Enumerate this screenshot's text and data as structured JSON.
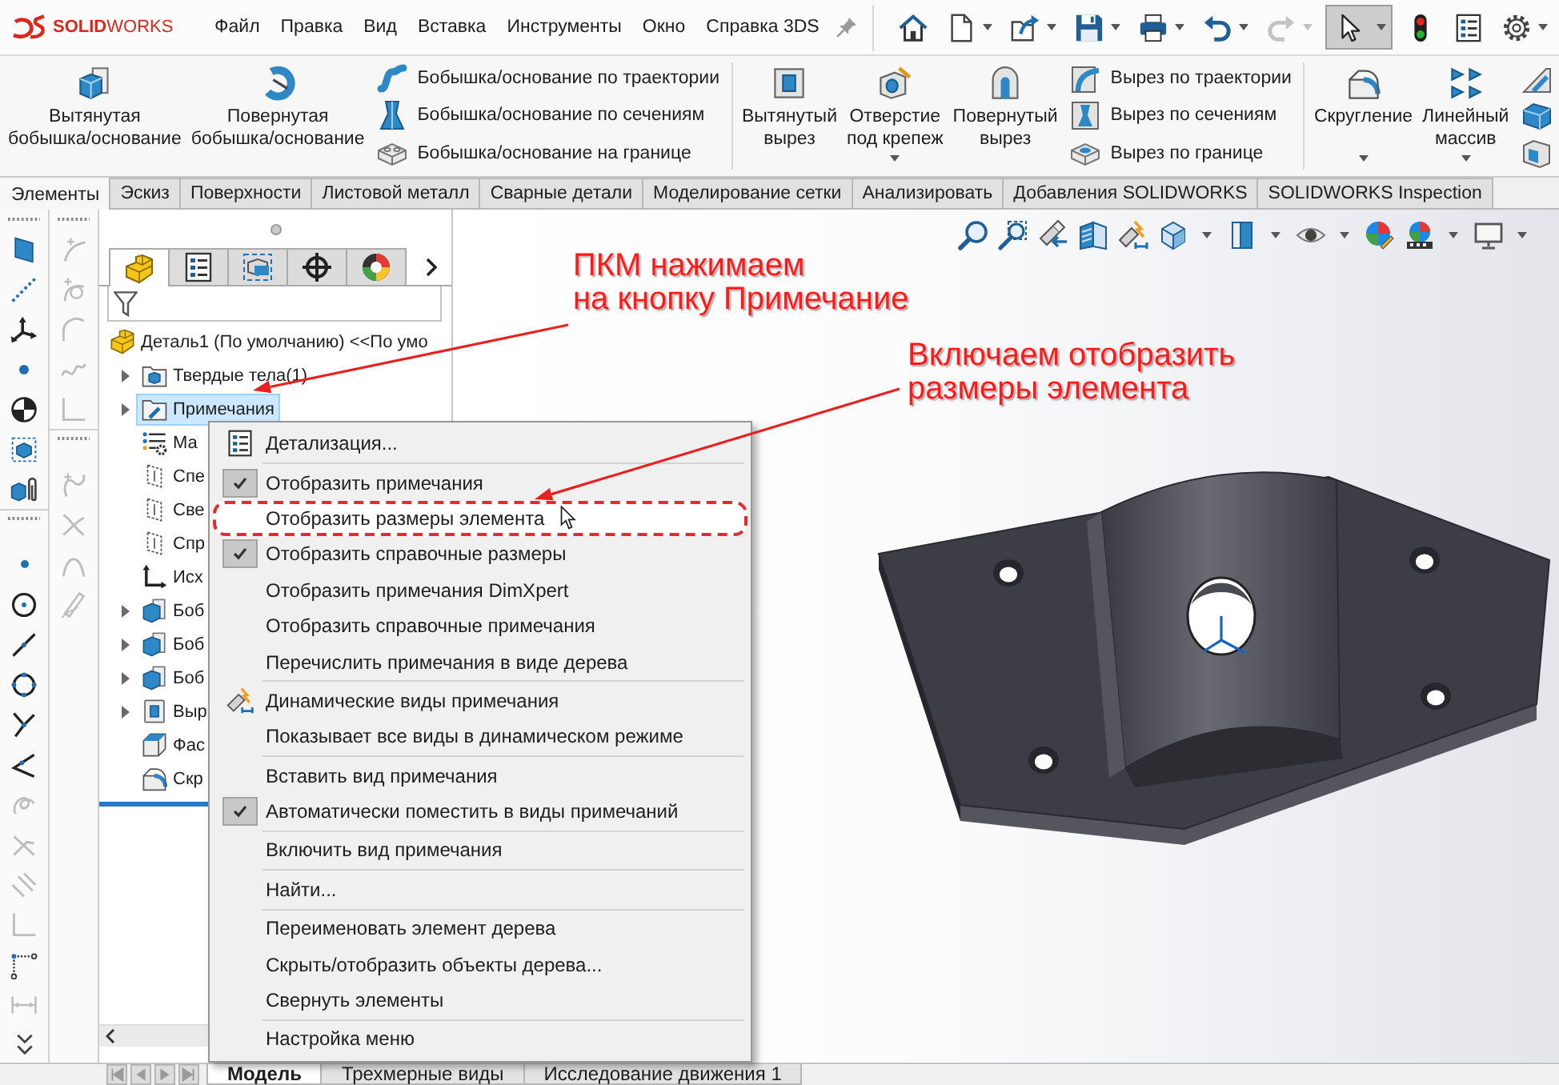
{
  "title_bar": {
    "logo": "**SOLID**WORKS",
    "menu": [
      "Файл",
      "Правка",
      "Вид",
      "Вставка",
      "Инструменты",
      "Окно",
      "Справка 3DS"
    ],
    "quick_access": [
      {
        "kind": "home",
        "dropdown": false,
        "disabled": false,
        "pressed": false
      },
      {
        "kind": "new",
        "dropdown": true,
        "disabled": false,
        "pressed": false
      },
      {
        "kind": "open",
        "dropdown": true,
        "disabled": false,
        "pressed": false
      },
      {
        "kind": "save",
        "dropdown": true,
        "disabled": false,
        "pressed": false
      },
      {
        "kind": "print",
        "dropdown": true,
        "disabled": false,
        "pressed": false
      },
      {
        "kind": "undo",
        "dropdown": true,
        "disabled": false,
        "pressed": false
      },
      {
        "kind": "redo",
        "dropdown": true,
        "disabled": true,
        "pressed": false
      },
      {
        "kind": "select",
        "dropdown": true,
        "disabled": false,
        "pressed": true
      },
      {
        "kind": "rebuild",
        "dropdown": false,
        "disabled": false,
        "pressed": false
      },
      {
        "kind": "properties",
        "dropdown": false,
        "disabled": false,
        "pressed": false
      },
      {
        "kind": "options",
        "dropdown": true,
        "disabled": false,
        "pressed": false
      }
    ]
  },
  "ribbon": {
    "groups": [
      {
        "large": [
          {
            "kind": "extruded-boss",
            "label": "Вытянутая\nбобышка/основание",
            "dropdown": false
          },
          {
            "kind": "revolved-boss",
            "label": "Повернутая\nбобышка/основание",
            "dropdown": false
          }
        ],
        "small": [
          {
            "kind": "swept-boss",
            "label": "Бобышка/основание по траектории"
          },
          {
            "kind": "lofted-boss",
            "label": "Бобышка/основание по сечениям"
          },
          {
            "kind": "boundary-boss",
            "label": "Бобышка/основание на границе"
          }
        ]
      },
      {
        "large": [
          {
            "kind": "extruded-cut",
            "label": "Вытянутый\nвырез",
            "dropdown": false
          },
          {
            "kind": "hole-wizard",
            "label": "Отверстие\nпод крепеж",
            "dropdown": true
          },
          {
            "kind": "revolved-cut",
            "label": "Повернутый\nвырез",
            "dropdown": false
          }
        ],
        "small": [
          {
            "kind": "swept-cut",
            "label": "Вырез по траектории"
          },
          {
            "kind": "lofted-cut",
            "label": "Вырез по сечениям"
          },
          {
            "kind": "boundary-cut",
            "label": "Вырез по границе"
          }
        ]
      },
      {
        "large": [
          {
            "kind": "fillet",
            "label": "Скругление",
            "dropdown": true
          },
          {
            "kind": "linear-pattern",
            "label": "Линейный\nмассив",
            "dropdown": true
          }
        ],
        "small": [
          {
            "kind": "rib"
          },
          {
            "kind": "draft"
          },
          {
            "kind": "shell"
          }
        ]
      }
    ]
  },
  "command_tabs": [
    {
      "label": "Элементы",
      "selected": true
    },
    {
      "label": "Эскиз",
      "selected": false
    },
    {
      "label": "Поверхности",
      "selected": false
    },
    {
      "label": "Листовой металл",
      "selected": false
    },
    {
      "label": "Сварные детали",
      "selected": false
    },
    {
      "label": "Моделирование сетки",
      "selected": false
    },
    {
      "label": "Анализировать",
      "selected": false
    },
    {
      "label": "Добавления SOLIDWORKS",
      "selected": false
    },
    {
      "label": "SOLIDWORKS Inspection",
      "selected": false
    }
  ],
  "left_toolbars": [
    {
      "groups": [
        [
          {
            "kind": "plane",
            "disabled": false
          },
          {
            "kind": "axis",
            "disabled": false
          },
          {
            "kind": "coordinate-system",
            "disabled": false
          },
          {
            "kind": "point",
            "disabled": false
          },
          {
            "kind": "center-of-mass",
            "disabled": false
          },
          {
            "kind": "bounding-box",
            "disabled": false
          },
          {
            "kind": "mate-reference",
            "disabled": false
          }
        ],
        [
          {
            "kind": "sketch-point",
            "disabled": false
          },
          {
            "kind": "circle",
            "disabled": false
          },
          {
            "kind": "line",
            "disabled": false
          },
          {
            "kind": "perimeter-circle",
            "disabled": false
          },
          {
            "kind": "trim",
            "disabled": false
          },
          {
            "kind": "extend",
            "disabled": false
          },
          {
            "kind": "offset",
            "disabled": true
          },
          {
            "kind": "mirror",
            "disabled": true
          },
          {
            "kind": "parallel",
            "disabled": true
          },
          {
            "kind": "corner",
            "disabled": true
          },
          {
            "kind": "construction",
            "disabled": false
          },
          {
            "kind": "dimension",
            "disabled": true
          }
        ]
      ],
      "more": true
    },
    {
      "groups": [
        [
          {
            "kind": "sparkle-curve",
            "disabled": true
          },
          {
            "kind": "arc-curve",
            "disabled": true
          },
          {
            "kind": "arc",
            "disabled": true
          },
          {
            "kind": "wave",
            "disabled": true
          },
          {
            "kind": "corner",
            "disabled": true
          }
        ],
        [
          {
            "kind": "offset-curve",
            "disabled": true
          },
          {
            "kind": "cross-curve",
            "disabled": true
          },
          {
            "kind": "parabola",
            "disabled": true
          },
          {
            "kind": "pen",
            "disabled": true
          }
        ]
      ],
      "more": false
    }
  ],
  "feature_panel": {
    "tabs": [
      {
        "kind": "features",
        "selected": true
      },
      {
        "kind": "properties",
        "selected": false
      },
      {
        "kind": "configurations",
        "selected": false
      },
      {
        "kind": "dimxpert",
        "selected": false
      },
      {
        "kind": "display",
        "selected": false
      }
    ],
    "tree": [
      {
        "label": "Деталь1 (По умолчанию) <<По умо",
        "kind": "part",
        "selected": false,
        "expandable": false,
        "children": [
          {
            "label": "Твердые тела(1)",
            "kind": "bodies",
            "selected": false,
            "expandable": true
          },
          {
            "label": "Примечания",
            "kind": "annotations",
            "selected": true,
            "expandable": true
          },
          {
            "label": "Ма",
            "kind": "material",
            "selected": false,
            "expandable": false
          },
          {
            "label": "Спе",
            "kind": "plane",
            "selected": false,
            "expandable": false
          },
          {
            "label": "Све",
            "kind": "plane",
            "selected": false,
            "expandable": false
          },
          {
            "label": "Спр",
            "kind": "plane",
            "selected": false,
            "expandable": false
          },
          {
            "label": "Исх",
            "kind": "origin",
            "selected": false,
            "expandable": false
          },
          {
            "label": "Боб",
            "kind": "boss",
            "selected": false,
            "expandable": true
          },
          {
            "label": "Боб",
            "kind": "boss",
            "selected": false,
            "expandable": true
          },
          {
            "label": "Боб",
            "kind": "boss",
            "selected": false,
            "expandable": true
          },
          {
            "label": "Выр",
            "kind": "cut",
            "selected": false,
            "expandable": true
          },
          {
            "label": "Фас",
            "kind": "chamfer",
            "selected": false,
            "expandable": false
          },
          {
            "label": "Скр",
            "kind": "fillet",
            "selected": false,
            "expandable": false
          }
        ]
      }
    ]
  },
  "callouts": [
    {
      "text": "ПКМ нажимаем\nна кнопку Примечание"
    },
    {
      "text": "Включаем отобразить\nразмеры элемента"
    }
  ],
  "context_menu": {
    "groups": [
      [
        {
          "label": "Детализация...",
          "kind": "details",
          "checked": false,
          "highlighted": false
        }
      ],
      [
        {
          "label": "Отобразить примечания",
          "kind": "plain",
          "checked": true,
          "highlighted": false
        },
        {
          "label": "Отобразить размеры элемента",
          "kind": "plain",
          "checked": false,
          "highlighted": true
        },
        {
          "label": "Отобразить справочные размеры",
          "kind": "plain",
          "checked": true,
          "highlighted": false
        },
        {
          "label": "Отобразить примечания DimXpert",
          "kind": "plain",
          "checked": false,
          "highlighted": false
        },
        {
          "label": "Отобразить справочные примечания",
          "kind": "plain",
          "checked": false,
          "highlighted": false
        },
        {
          "label": "Перечислить примечания в виде дерева",
          "kind": "plain",
          "checked": false,
          "highlighted": false
        }
      ],
      [
        {
          "label": "Динамические виды примечания",
          "kind": "dynamic",
          "checked": false,
          "highlighted": false
        },
        {
          "label": "Показывает все виды в динамическом режиме",
          "kind": "plain",
          "checked": false,
          "highlighted": false
        }
      ],
      [
        {
          "label": "Вставить вид примечания",
          "kind": "plain",
          "checked": false,
          "highlighted": false
        },
        {
          "label": "Автоматически поместить в виды примечаний",
          "kind": "plain",
          "checked": true,
          "highlighted": false
        }
      ],
      [
        {
          "label": "Включить вид примечания",
          "kind": "plain",
          "checked": false,
          "highlighted": false
        }
      ],
      [
        {
          "label": "Найти...",
          "kind": "plain",
          "checked": false,
          "highlighted": false
        }
      ],
      [
        {
          "label": "Переименовать элемент дерева",
          "kind": "plain",
          "checked": false,
          "highlighted": false
        },
        {
          "label": "Скрыть/отобразить объекты дерева...",
          "kind": "plain",
          "checked": false,
          "highlighted": false
        },
        {
          "label": "Свернуть элементы",
          "kind": "plain",
          "checked": false,
          "highlighted": false
        }
      ],
      [
        {
          "label": "Настройка меню",
          "kind": "plain",
          "checked": false,
          "highlighted": false
        }
      ]
    ]
  },
  "bottom_tabs": [
    {
      "label": "Модель",
      "selected": true
    },
    {
      "label": "Трехмерные виды",
      "selected": false
    },
    {
      "label": "Исследование движения 1",
      "selected": false
    }
  ]
}
